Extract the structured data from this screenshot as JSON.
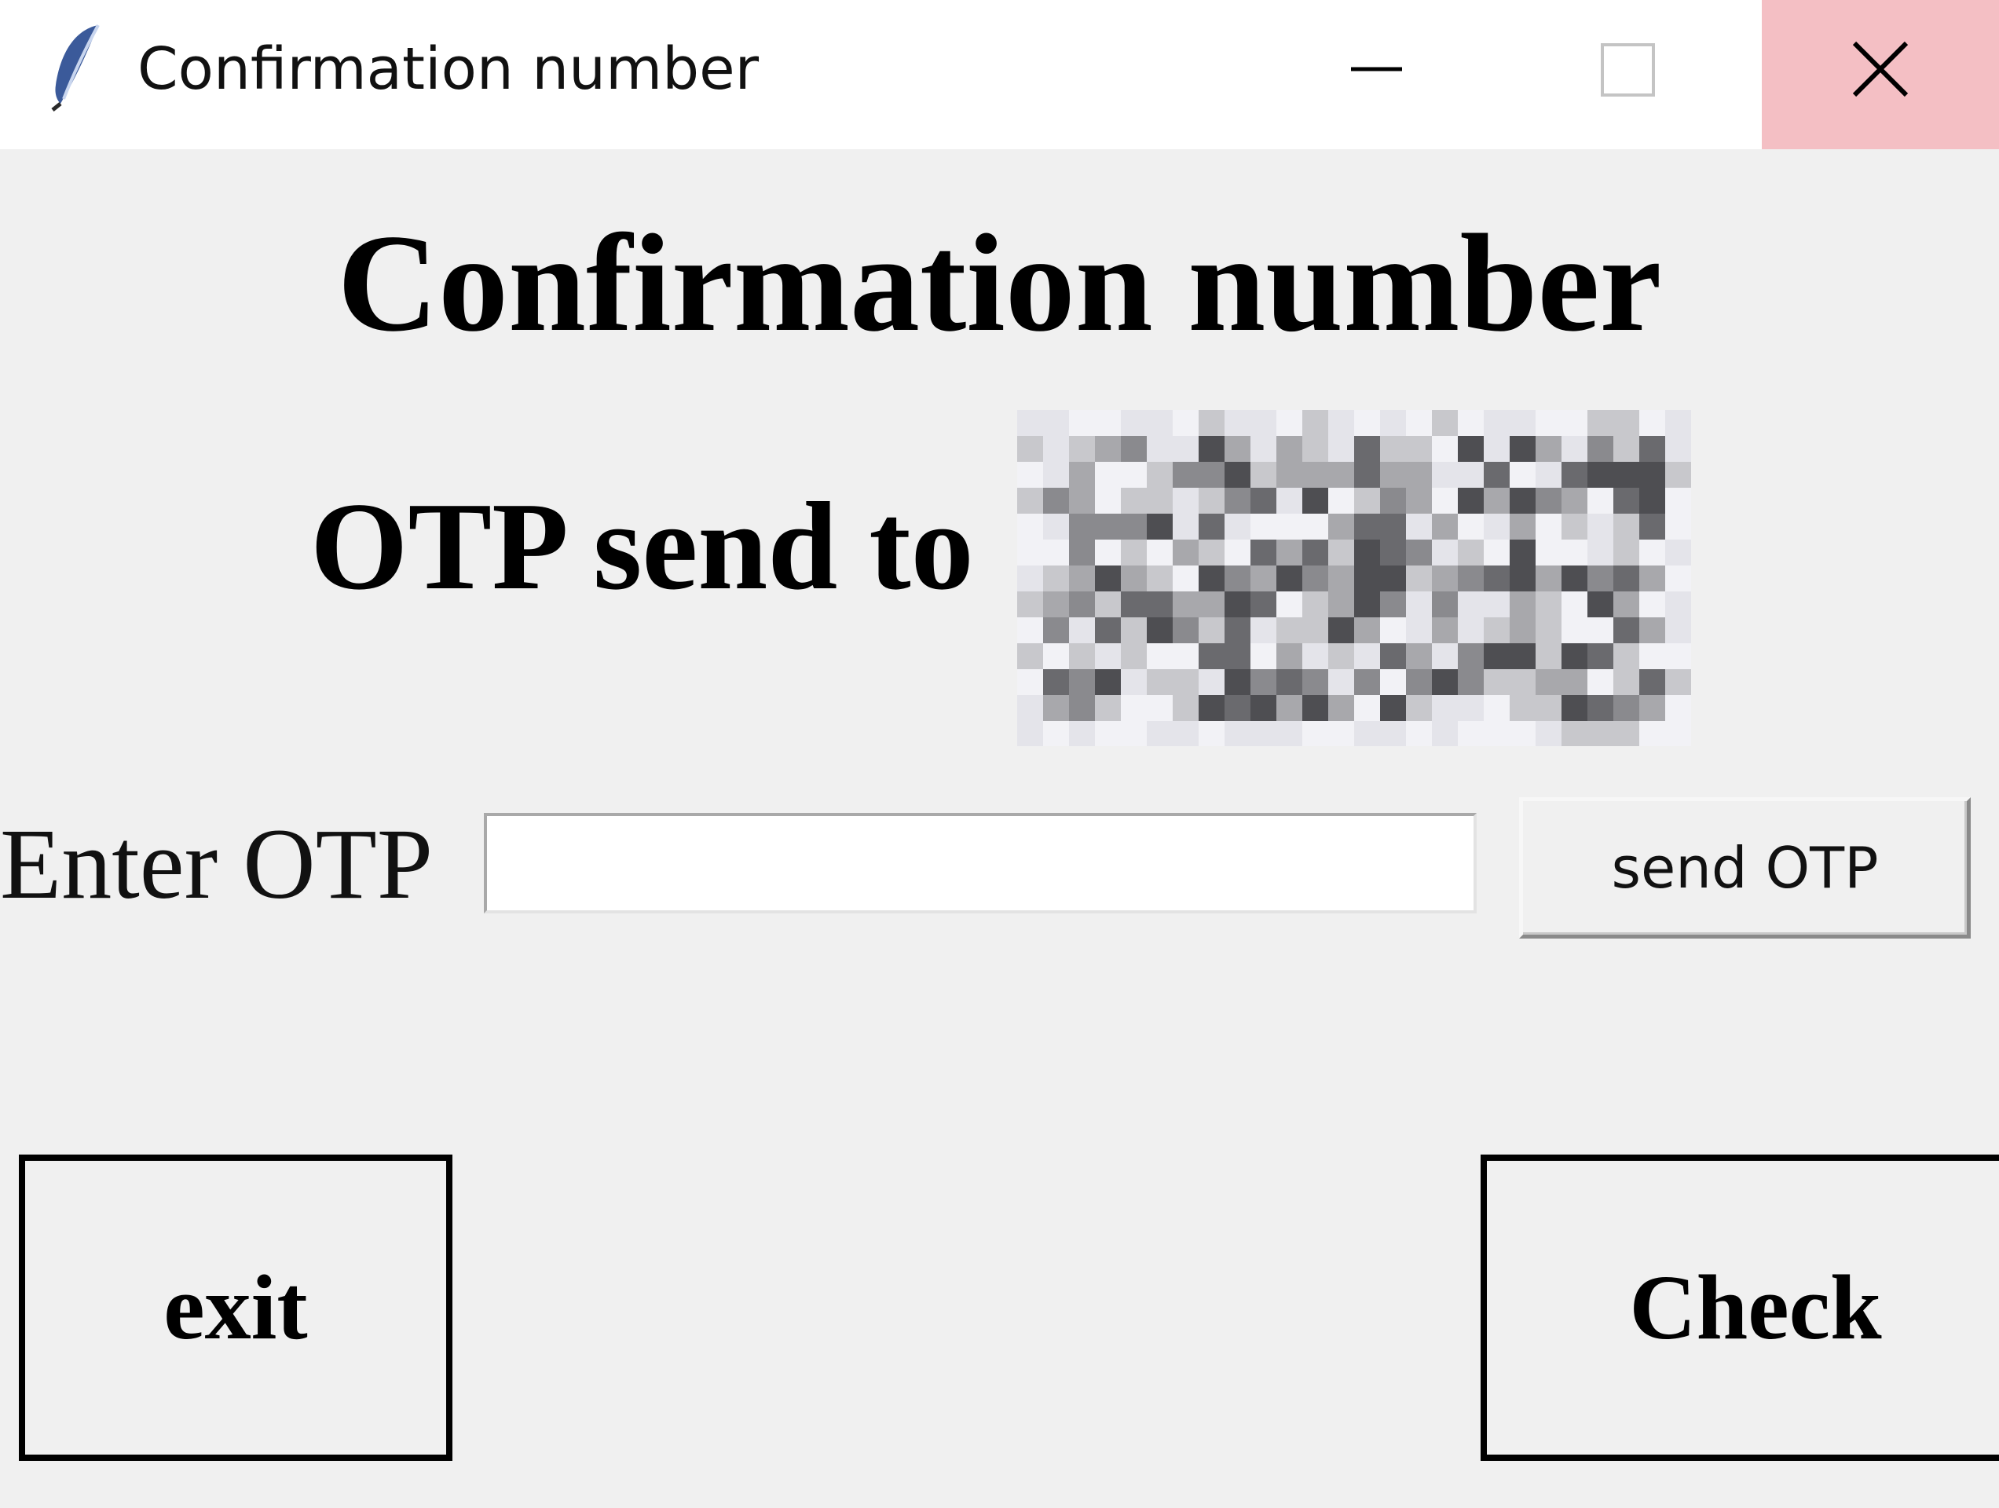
{
  "window": {
    "title": "Confirmation number",
    "icon": "feather-icon",
    "controls": {
      "minimize_icon": "minimize-icon",
      "maximize_icon": "maximize-icon",
      "close_icon": "close-icon",
      "close_hover_color": "#f4bfc4"
    }
  },
  "main": {
    "heading": "Confirmation number",
    "otp_sent_label": "OTP send to",
    "recipient_redacted": true,
    "enter_label": "Enter OTP",
    "otp_input_value": "",
    "send_button_label": "send OTP",
    "exit_button_label": "exit",
    "check_button_label": "Check"
  },
  "colors": {
    "background": "#f0f0f0",
    "titlebar": "#ffffff"
  }
}
